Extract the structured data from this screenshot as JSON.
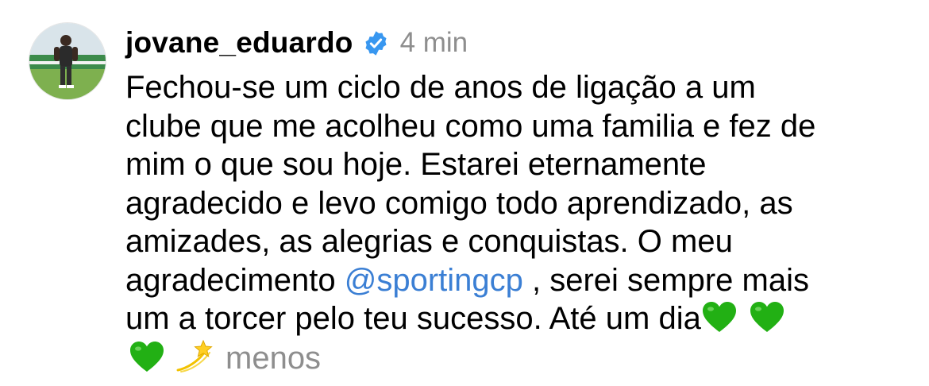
{
  "post": {
    "username": "jovane_eduardo",
    "time": "4 min",
    "caption_lines": {
      "l1": "Fechou-se um ciclo de anos de ligação a um",
      "l2": "clube que me acolheu como uma familia e fez de",
      "l3": "mim o que sou hoje. Estarei eternamente",
      "l4": "agradecido e levo comigo todo aprendizado, as",
      "l5": "amizades, as alegrias e conquistas. O meu",
      "l6_before": "agradecimento ",
      "l6_mention": "@sportingcp",
      "l6_after": " , serei sempre mais",
      "l7": "um a torcer pelo teu sucesso. Até um dia"
    },
    "less_label": "menos",
    "emojis": [
      "green-heart",
      "green-heart",
      "green-heart",
      "dizzy-star"
    ]
  },
  "colors": {
    "text": "#000000",
    "muted": "#8e8e8e",
    "mention": "#3b7fd4",
    "verified": "#3897f0",
    "green_heart": "#22b014"
  }
}
